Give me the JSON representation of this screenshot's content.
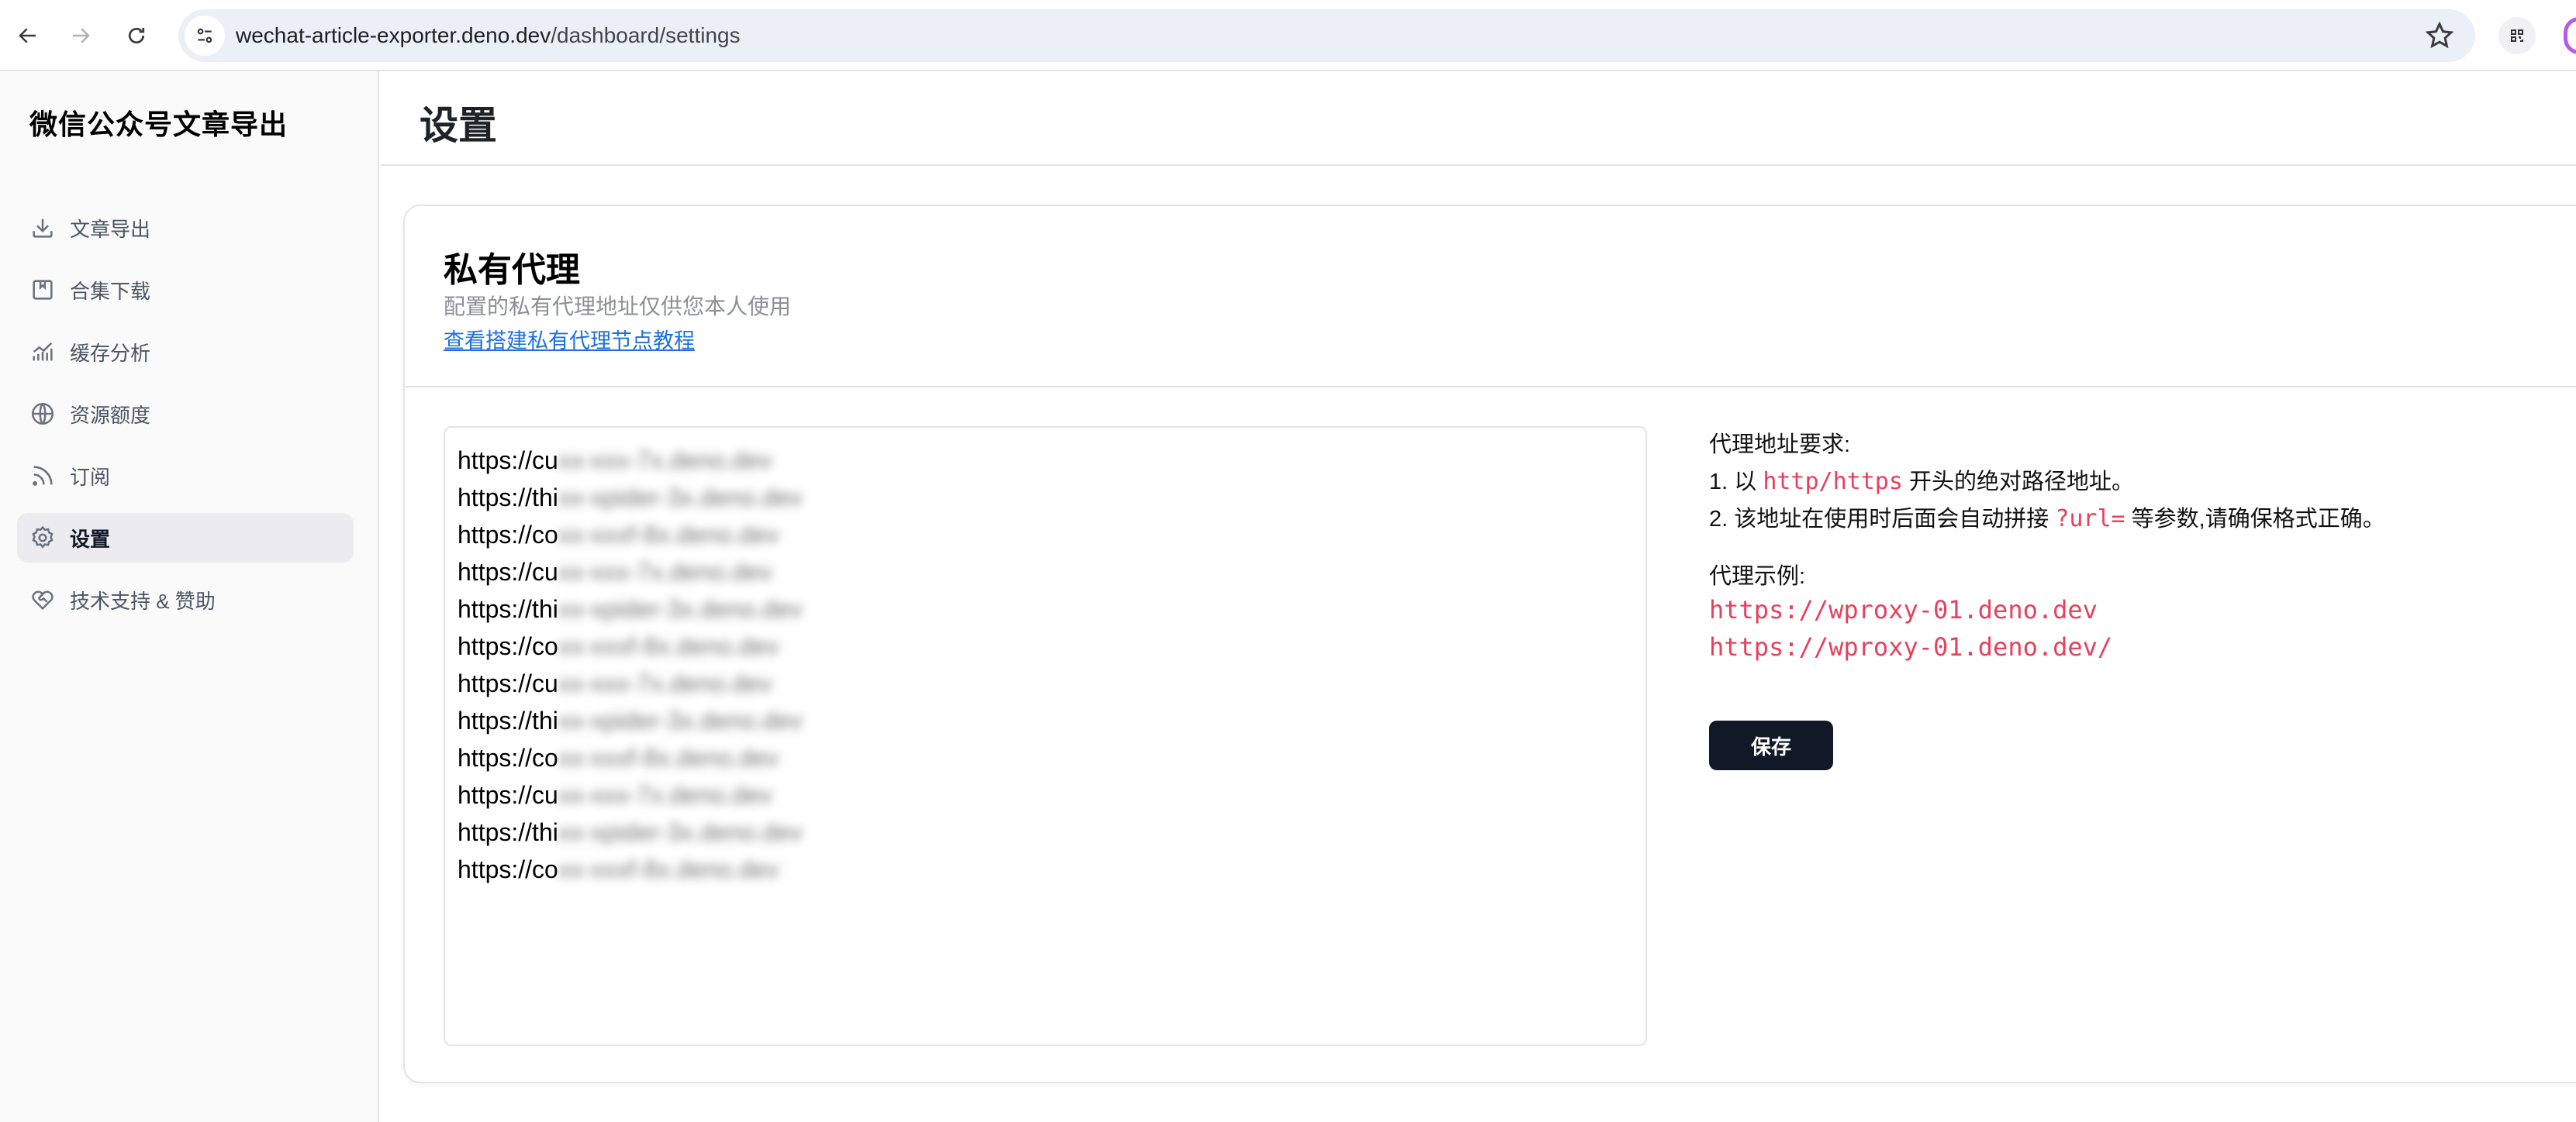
{
  "browser": {
    "url_host": "wechat-article-exporter.deno.dev",
    "url_path": "/dashboard/settings",
    "icons": [
      "back-arrow-icon",
      "forward-arrow-icon",
      "reload-icon",
      "site-info-icon",
      "star-icon",
      "qr-extension-icon",
      "profile-icon"
    ]
  },
  "sidebar": {
    "brand": "微信公众号文章导出",
    "items": [
      {
        "label": "文章导出",
        "icon": "download-icon",
        "active": false
      },
      {
        "label": "合集下载",
        "icon": "bookmark-book-icon",
        "active": false
      },
      {
        "label": "缓存分析",
        "icon": "chart-icon",
        "active": false
      },
      {
        "label": "资源额度",
        "icon": "globe-icon",
        "active": false
      },
      {
        "label": "订阅",
        "icon": "rss-icon",
        "active": false
      },
      {
        "label": "设置",
        "icon": "gear-icon",
        "active": true
      },
      {
        "label": "技术支持 & 赞助",
        "icon": "heart-handshake-icon",
        "active": false
      }
    ]
  },
  "header": {
    "title": "设置"
  },
  "proxy_card": {
    "title": "私有代理",
    "description": "配置的私有代理地址仅供您本人使用",
    "tutorial_link": "查看搭建私有代理节点教程",
    "proxy_list": [
      {
        "visible": "https://cu",
        "redacted": "xx-xxx-7x.deno.dev"
      },
      {
        "visible": "https://thi",
        "redacted": "xx-xpider-3x.deno.dev"
      },
      {
        "visible": "https://co",
        "redacted": "xx-xxxf-8x.deno.dev"
      },
      {
        "visible": "https://cu",
        "redacted": "xx-xxx-7x.deno.dev"
      },
      {
        "visible": "https://thi",
        "redacted": "xx-xpider-3x.deno.dev"
      },
      {
        "visible": "https://co",
        "redacted": "xx-xxxf-8x.deno.dev"
      },
      {
        "visible": "https://cu",
        "redacted": "xx-xxx-7x.deno.dev"
      },
      {
        "visible": "https://thi",
        "redacted": "xx-xpider-3x.deno.dev"
      },
      {
        "visible": "https://co",
        "redacted": "xx-xxxf-8x.deno.dev"
      },
      {
        "visible": "https://cu",
        "redacted": "xx-xxx-7x.deno.dev"
      },
      {
        "visible": "https://thi",
        "redacted": "xx-xpider-3x.deno.dev"
      },
      {
        "visible": "https://co",
        "redacted": "xx-xxxf-8x.deno.dev"
      }
    ],
    "requirements_title": "代理地址要求:",
    "req1_prefix": "1. 以 ",
    "req1_code": "http/https",
    "req1_suffix": " 开头的绝对路径地址。",
    "req2_prefix": "2. 该地址在使用时后面会自动拼接 ",
    "req2_code": "?url=",
    "req2_suffix": " 等参数,请确保格式正确。",
    "examples_title": "代理示例:",
    "examples": [
      "https://wproxy-01.deno.dev",
      "https://wproxy-01.deno.dev/"
    ],
    "save_label": "保存"
  },
  "colors": {
    "accent_code": "#e8405c",
    "link": "#1d6fe0",
    "primary_button": "#111827"
  }
}
